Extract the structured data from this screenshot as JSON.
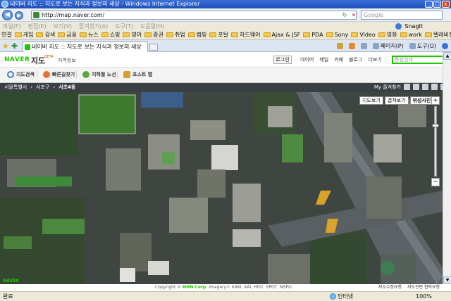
{
  "window": {
    "title": "네이버 지도 :: 지도로 보는 지식과 정보의 세상 - Windows Internet Explorer",
    "minimize": "_",
    "maximize": "□",
    "close": "x"
  },
  "navbar": {
    "back_icon": "◀",
    "forward_icon": "▶",
    "url": "http://map.naver.com/",
    "refresh_icon": "↻",
    "stop_icon": "✕",
    "go_icon": "→",
    "search_placeholder": "Google"
  },
  "menubar": {
    "items": [
      "파일(F)",
      "편집(E)",
      "보기(V)",
      "즐겨찾기(A)",
      "도구(T)",
      "도움말(H)"
    ],
    "snagit_label": "SnagIt"
  },
  "links": {
    "label": "연결",
    "items": [
      "게임",
      "검색",
      "금융",
      "뉴스",
      "쇼핑",
      "영어",
      "증권",
      "취업",
      "캠핑",
      "포탈",
      "하드웨어",
      "Ajax & JSF",
      "PDA",
      "Sony",
      "Video",
      "영화",
      "work",
      "텔레비전"
    ]
  },
  "tabbar": {
    "tab_label": "네이버 지도 :: 지도로 보는 지식과 정보의 세상",
    "commands": [
      "페이지(P)",
      "도구(O)"
    ]
  },
  "naver": {
    "logo": "NAVER",
    "service": "지도",
    "beta": "BETA",
    "region": "지역정보",
    "login": "로그인",
    "nav": [
      "네이버",
      "메일",
      "카페",
      "블로그",
      "더보기"
    ],
    "search_placeholder": "통합검색"
  },
  "tools": {
    "items": [
      "지도검색",
      "빠른길찾기",
      "지하철 노선",
      "포스트 맵"
    ],
    "colors": [
      "#3a7bd5",
      "#e5732d",
      "#5ba83b",
      "#d6a12a"
    ]
  },
  "breadcrumb": {
    "items": [
      "서울특별시",
      "서초구",
      "서초4동"
    ],
    "my_region": "My 즐겨찾기"
  },
  "map": {
    "view_tabs": [
      "지도보기",
      "겹쳐보기",
      "위성사진"
    ],
    "active_view": 2,
    "zoom_plus": "+",
    "zoom_minus": "−",
    "zoom_level_fraction": 0.25,
    "copyright_prefix": "Copyright ©",
    "copyright_company": "NHN Corp.",
    "copyright_rest": "Imagery© KAKI, KAI, HIST, SPOT, NSPO",
    "footer_links": [
      "지도수정요청",
      "지도관련 협력요청"
    ],
    "watermark": "NAVER"
  },
  "statusbar": {
    "text": "완료",
    "zone": "인터넷",
    "zoom": "100%"
  }
}
